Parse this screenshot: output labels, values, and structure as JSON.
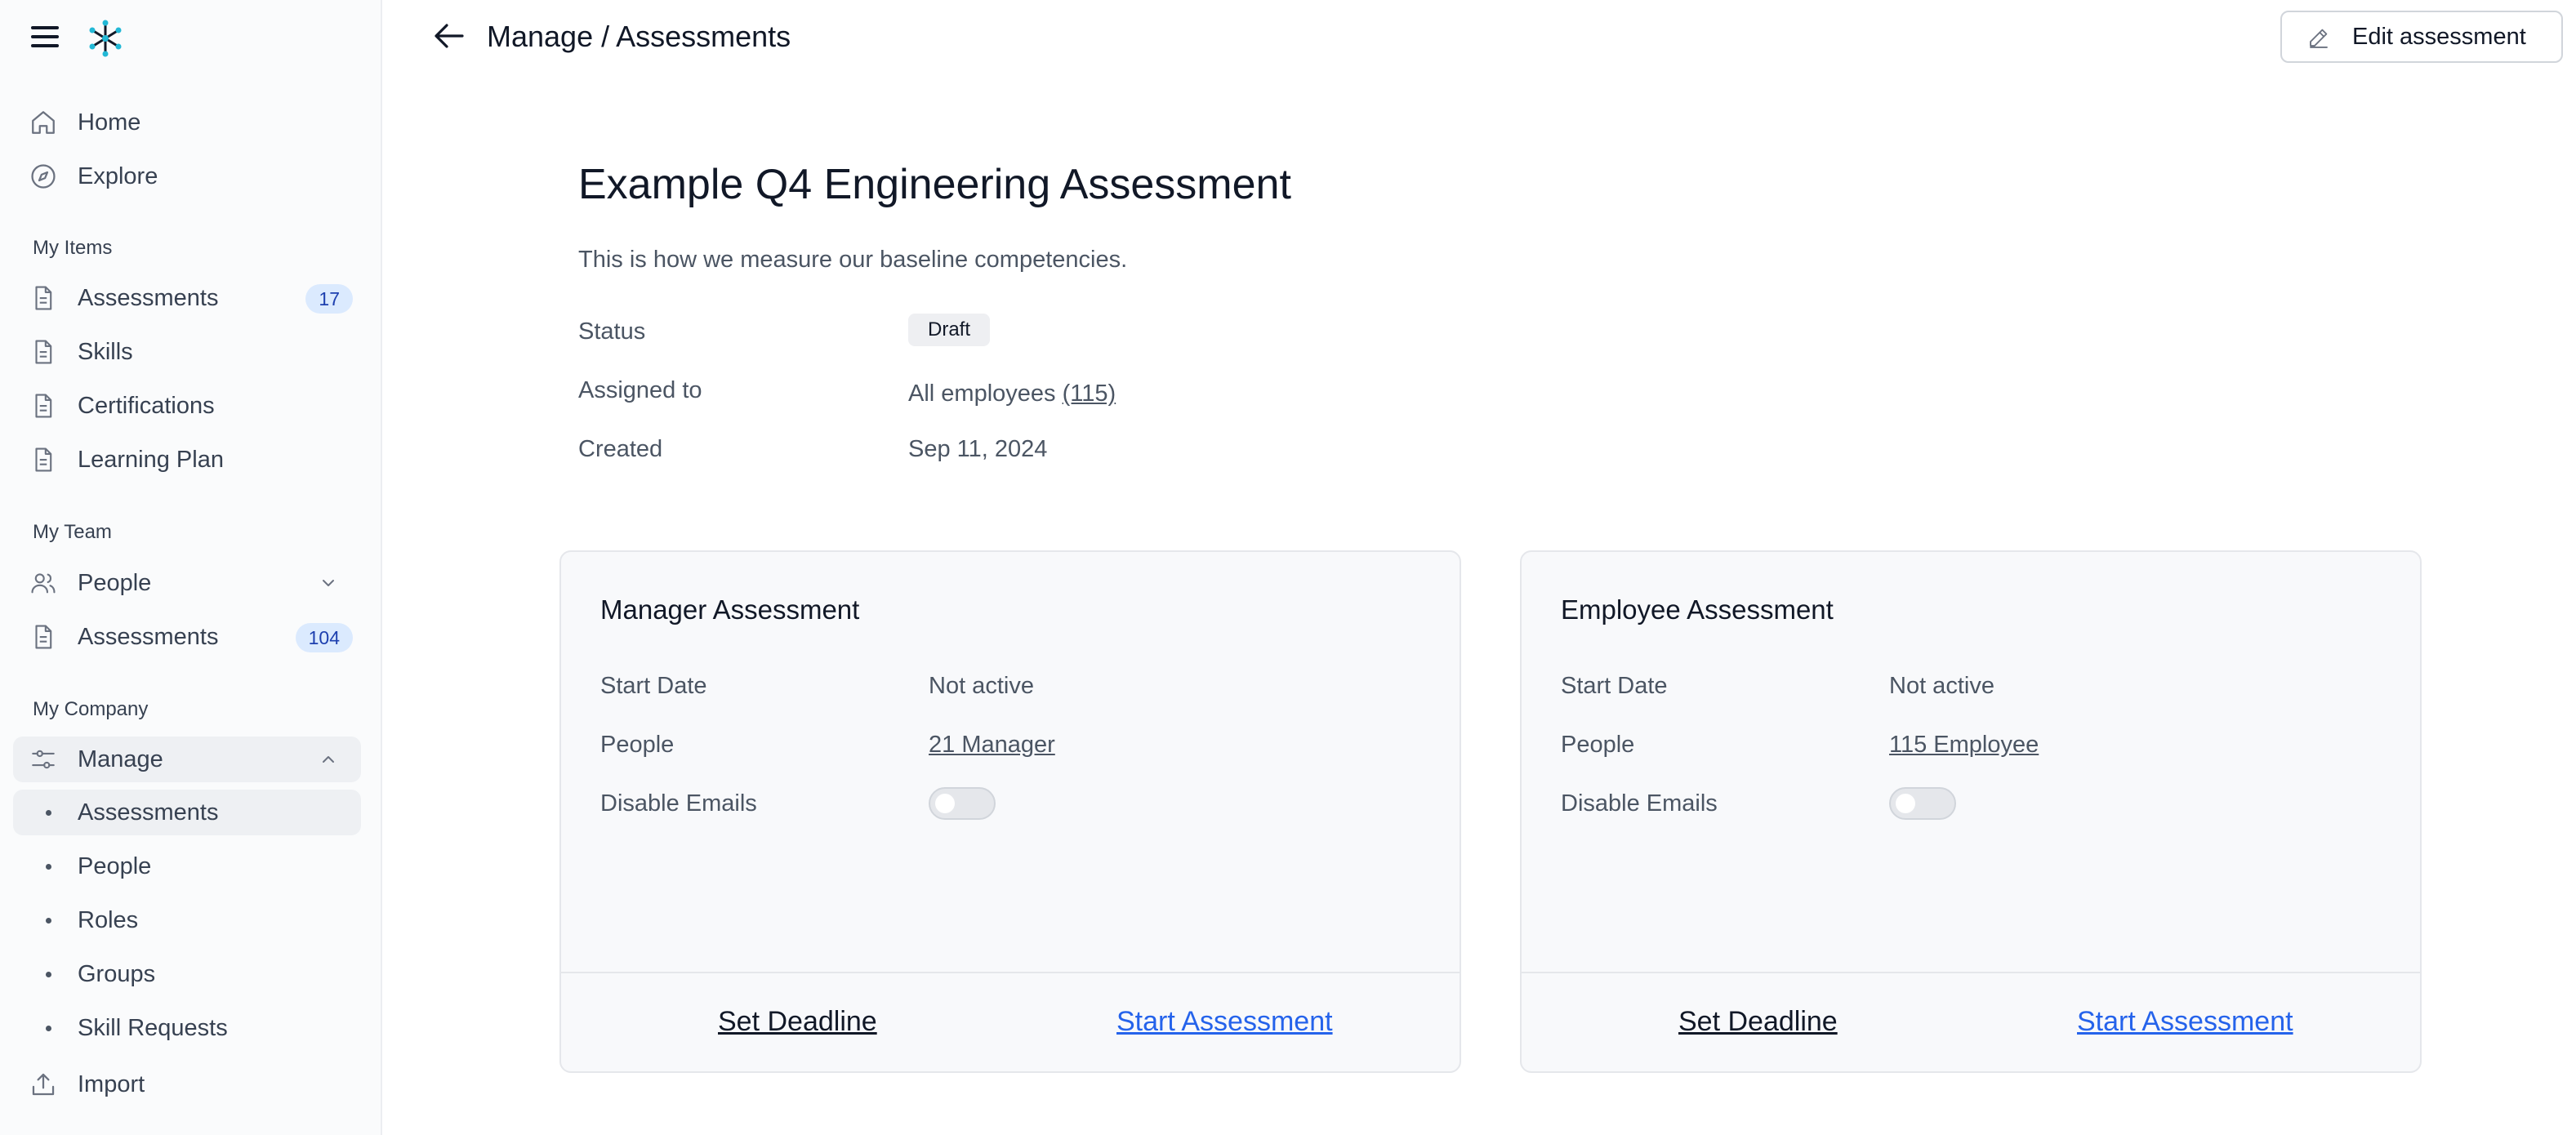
{
  "sidebar": {
    "home": "Home",
    "explore": "Explore",
    "my_items_title": "My Items",
    "my_items": [
      {
        "label": "Assessments",
        "badge": "17"
      },
      {
        "label": "Skills"
      },
      {
        "label": "Certifications"
      },
      {
        "label": "Learning Plan"
      }
    ],
    "my_team_title": "My Team",
    "team_people": "People",
    "team_assessments": "Assessments",
    "team_assessments_badge": "104",
    "my_company_title": "My Company",
    "manage": "Manage",
    "manage_sub": [
      "Assessments",
      "People",
      "Roles",
      "Groups",
      "Skill Requests"
    ],
    "import": "Import"
  },
  "header": {
    "breadcrumb": "Manage / Assessments",
    "edit_button": "Edit assessment"
  },
  "assessment": {
    "title": "Example Q4 Engineering Assessment",
    "description": "This is how we measure our baseline competencies.",
    "status_label": "Status",
    "status_value": "Draft",
    "assigned_label": "Assigned to",
    "assigned_value": "All employees",
    "assigned_count": "(115)",
    "created_label": "Created",
    "created_value": "Sep 11, 2024"
  },
  "cards": [
    {
      "title": "Manager Assessment",
      "start_date_label": "Start Date",
      "start_date_value": "Not active",
      "people_label": "People",
      "people_value": "21 Manager",
      "disable_emails_label": "Disable Emails",
      "disable_emails": false,
      "set_deadline": "Set Deadline",
      "start_assessment": "Start Assessment"
    },
    {
      "title": "Employee Assessment",
      "start_date_label": "Start Date",
      "start_date_value": "Not active",
      "people_label": "People",
      "people_value": "115 Employee",
      "disable_emails_label": "Disable Emails",
      "disable_emails": false,
      "set_deadline": "Set Deadline",
      "start_assessment": "Start Assessment"
    }
  ],
  "colors": {
    "accent_link": "#2563eb",
    "badge_bg": "#dbeafe",
    "badge_text": "#1e40af",
    "active_nav_bg": "#eef0f3"
  }
}
